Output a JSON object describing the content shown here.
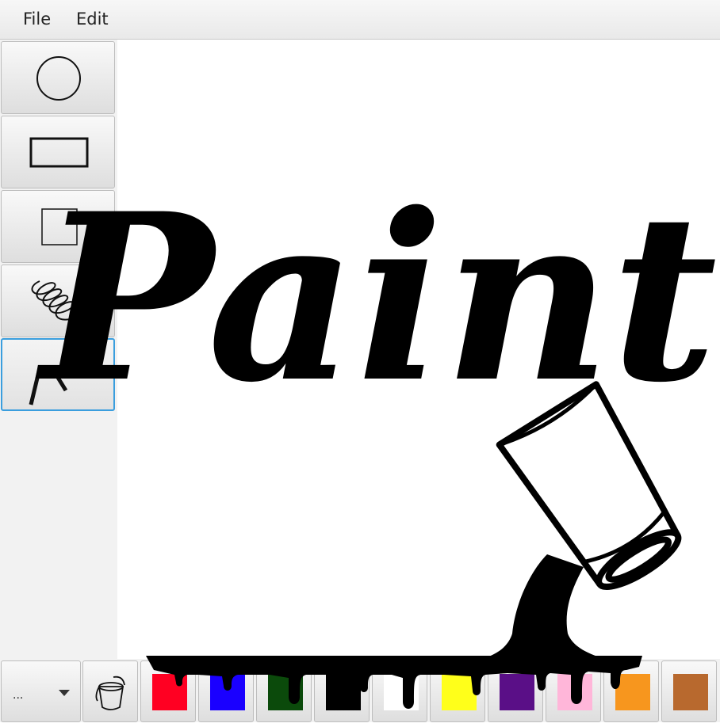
{
  "menu": {
    "file_label": "File",
    "edit_label": "Edit"
  },
  "tools": [
    {
      "name": "circle-tool",
      "icon": "circle-icon"
    },
    {
      "name": "rectangle-tool",
      "icon": "rectangle-icon"
    },
    {
      "name": "square-tool",
      "icon": "square-icon"
    },
    {
      "name": "freehand-tool",
      "icon": "scribble-icon"
    },
    {
      "name": "polyline-tool",
      "icon": "polyline-icon",
      "selected": true
    }
  ],
  "brush_size": {
    "value": "..."
  },
  "fill_tool": {
    "icon": "paint-bucket-icon"
  },
  "colors": [
    "#ff0022",
    "#1a00ff",
    "#0b4a0b",
    "#000000",
    "#ffffff",
    "#ffff1a",
    "#5a0f87",
    "#ffb6d9",
    "#f7961e",
    "#b8692e"
  ],
  "canvas": {
    "logo_text": "Paint",
    "logo_color": "#000000"
  }
}
